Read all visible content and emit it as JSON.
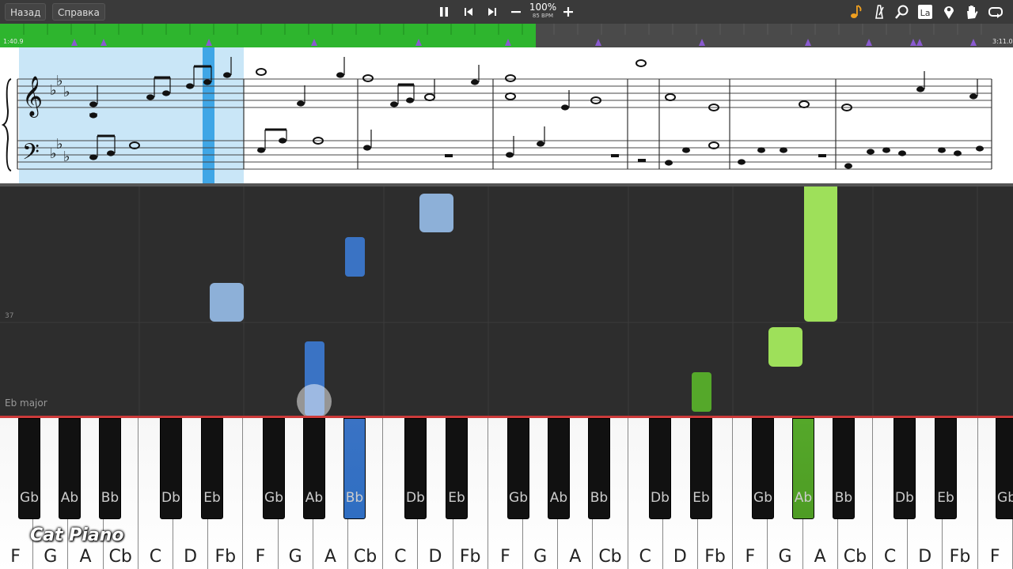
{
  "toolbar": {
    "back_label": "Назад",
    "help_label": "Справка",
    "tempo_percent": "100%",
    "tempo_bpm": "85 BPM",
    "right_icons": [
      "note-icon",
      "metronome-icon",
      "search-icon",
      "note-labels-icon",
      "marker-icon",
      "hand-icon",
      "loop-icon"
    ]
  },
  "timeline": {
    "start_time": "1:40.9",
    "end_time": "3:11.0",
    "progress": 0.529
  },
  "roll": {
    "measure_number": "37",
    "key_signature": "Eb major"
  },
  "keyboard": {
    "white_keys": [
      "F",
      "G",
      "A",
      "Cb",
      "C",
      "D",
      "Fb",
      "F",
      "G",
      "A",
      "Cb",
      "C",
      "D",
      "Fb",
      "F",
      "G",
      "A",
      "Cb",
      "C",
      "D",
      "Fb",
      "F",
      "G",
      "A",
      "Cb",
      "C",
      "D",
      "Fb",
      "F"
    ],
    "black_keys": [
      "Gb",
      "Ab",
      "Bb",
      "Db",
      "Eb",
      "Gb",
      "Ab",
      "Bb",
      "Db",
      "Eb",
      "Gb",
      "Ab",
      "Bb",
      "Db",
      "Eb",
      "Gb",
      "Ab",
      "Bb",
      "Db",
      "Eb",
      "Gb"
    ],
    "active_black": {
      "4": "",
      "7": "#2f6ec2",
      "18": "#5fa82a"
    }
  },
  "colors": {
    "left_hand": "#3a73c4",
    "left_hand_light": "#8db0d8",
    "right_hand": "#9ee05a",
    "right_hand_dark": "#55a82a"
  },
  "watermark": "Cat Piano"
}
